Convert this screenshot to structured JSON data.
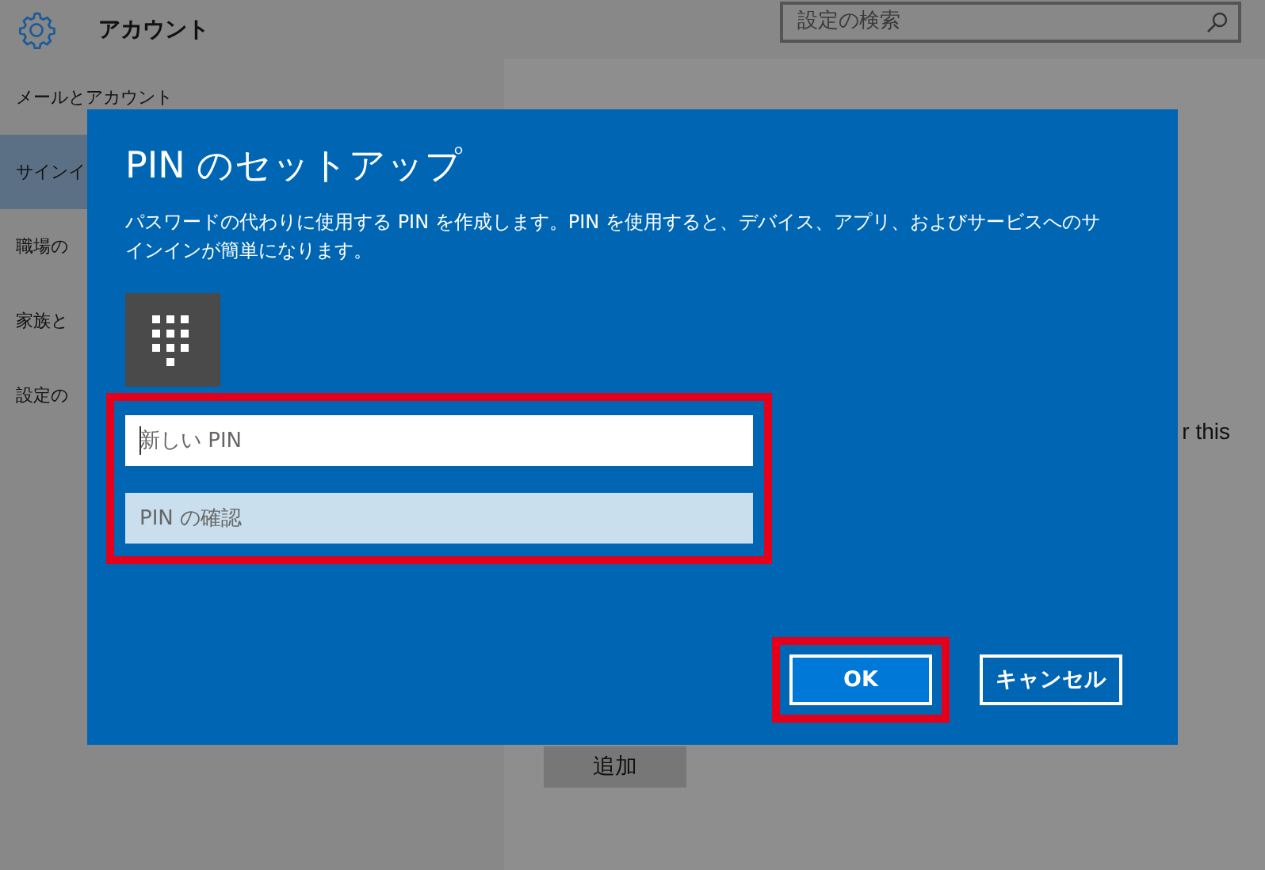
{
  "header": {
    "title": "アカウント",
    "search": {
      "placeholder": "設定の検索"
    }
  },
  "sidebar": {
    "items": [
      {
        "label": "メールとアカウント",
        "selected": false
      },
      {
        "label": "サインイ",
        "selected": true
      },
      {
        "label": "職場の",
        "selected": false
      },
      {
        "label": "家族と",
        "selected": false
      },
      {
        "label": "設定の",
        "selected": false
      }
    ]
  },
  "content": {
    "text_fragment": "r this",
    "add_button": "追加"
  },
  "dialog": {
    "title": "PIN のセットアップ",
    "description": "パスワードの代わりに使用する PIN を作成します。PIN を使用すると、デバイス、アプリ、およびサービスへのサインインが簡単になります。",
    "fields_highlighted": true,
    "fields": [
      {
        "placeholder": "新しい PIN",
        "focused": true
      },
      {
        "placeholder": "PIN の確認",
        "focused": false
      }
    ],
    "buttons": [
      {
        "label": "OK",
        "kind": "primary",
        "highlighted": true
      },
      {
        "label": "キャンセル",
        "kind": "secondary",
        "highlighted": false
      }
    ]
  }
}
